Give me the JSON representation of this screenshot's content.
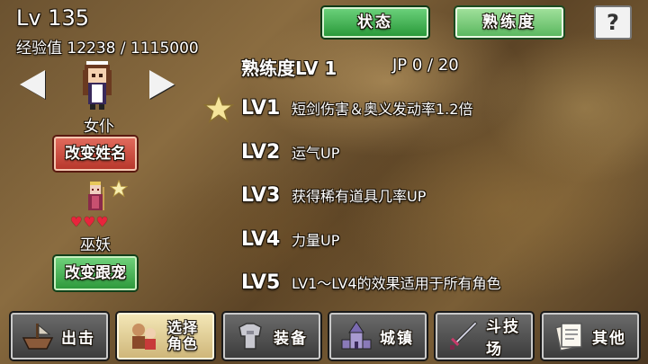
{
  "character": {
    "level": "Lv 135",
    "exp": "经验值 12238 / 1115000",
    "name": "女仆",
    "rename_button": "改变姓名"
  },
  "pet": {
    "name": "巫妖",
    "hearts": "♥♥♥",
    "hearts_count": 3,
    "change_button": "改变跟宠"
  },
  "tabs": {
    "status": "状态",
    "proficiency": "熟练度",
    "help": "?"
  },
  "proficiency": {
    "header": "熟练度LV 1",
    "jp": "JP 0 / 20",
    "levels": [
      {
        "tag": "LV1",
        "desc": "短剑伤害＆奥义发动率1.2倍",
        "starred": true
      },
      {
        "tag": "LV2",
        "desc": "运气UP"
      },
      {
        "tag": "LV3",
        "desc": "获得稀有道具几率UP"
      },
      {
        "tag": "LV4",
        "desc": "力量UP"
      },
      {
        "tag": "LV5",
        "desc": "LV1〜LV4的效果适用于所有角色"
      }
    ]
  },
  "bottom_menu": [
    {
      "label": "出击",
      "icon": "ship-icon"
    },
    {
      "label": "选择角色",
      "label_line1": "选择",
      "label_line2": "角色",
      "icon": "characters-icon",
      "active": true
    },
    {
      "label": "装备",
      "icon": "armor-icon"
    },
    {
      "label": "城镇",
      "icon": "town-icon"
    },
    {
      "label": "斗技场",
      "icon": "sword-icon"
    },
    {
      "label": "其他",
      "icon": "scroll-icon"
    }
  ],
  "colors": {
    "green_button": "#2e9a3c",
    "red_button": "#b8382c",
    "heart": "#e8243c",
    "star": "#f5e49a"
  }
}
